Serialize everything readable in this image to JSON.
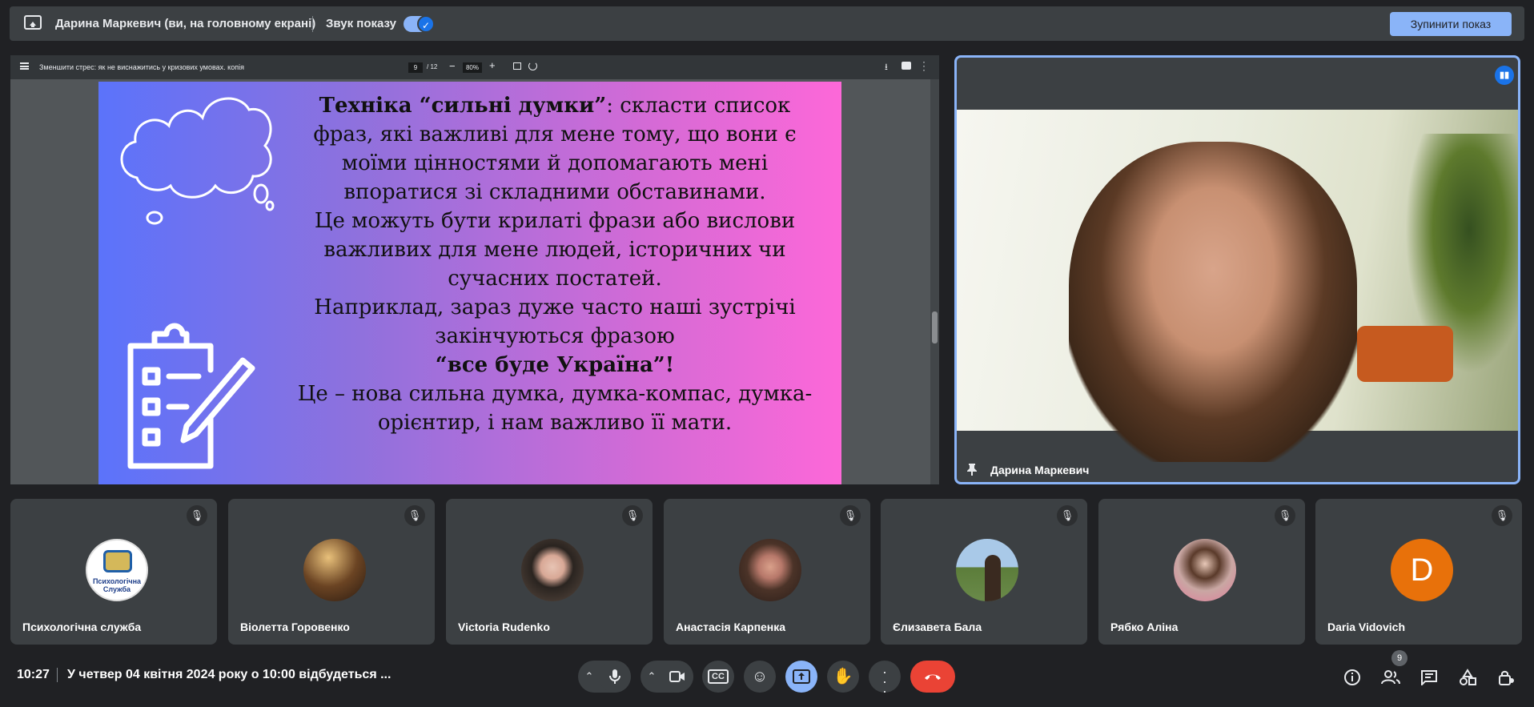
{
  "topbar": {
    "presenter": "Дарина Маркевич (ви, на головному екрані)",
    "sound_label": "Звук показу",
    "stop_label": "Зупинити показ"
  },
  "pdf": {
    "title": "Зменшити стрес: як не виснажитись у кризових умовах. копія",
    "page": "9",
    "pages_total": "/ 12",
    "zoom": "80%"
  },
  "slide": {
    "heading": "Техніка “сильні думки”",
    "line1": ": скласти список фраз, які важливі для мене тому, що вони є моїми цінностями й допомагають мені впоратися зі складними обставинами.",
    "line2": "Це можуть бути крилаті фрази або вислови важливих для мене людей, історичних чи сучасних постатей.",
    "line3": "Наприклад, зараз дуже часто наші зустрічі закінчуються фразою",
    "quote": "“все буде Україна”!",
    "line4": "Це – нова сильна думка, думка-компас, думка-орієнтир, і нам важливо її мати."
  },
  "speaker": {
    "name": "Дарина Маркевич"
  },
  "participants": [
    {
      "name": "Психологічна служба",
      "avatar_text": "Психологічна Служба",
      "color": "#ffffff"
    },
    {
      "name": "Віолетта Горовенко",
      "avatar_text": "",
      "color": "#3b2a1c"
    },
    {
      "name": "Victoria Rudenko",
      "avatar_text": "",
      "color": "#2a2420"
    },
    {
      "name": "Анастасія Карпенка",
      "avatar_text": "",
      "color": "#4b3328"
    },
    {
      "name": "Єлизавета Бала",
      "avatar_text": "",
      "color": "#6a8a4a"
    },
    {
      "name": "Рябко Аліна",
      "avatar_text": "",
      "color": "#c9a7a3"
    },
    {
      "name": "Daria Vidovich",
      "avatar_text": "D",
      "color": "#e8710a"
    }
  ],
  "bottom": {
    "time": "10:27",
    "meeting_title": "У четвер 04 квітня 2024 року о 10:00 відбудеться ...",
    "participant_count": "9"
  },
  "colors": {
    "accent": "#8ab4f8",
    "end_call": "#ea4335",
    "present_active": "#8ab4f8"
  }
}
